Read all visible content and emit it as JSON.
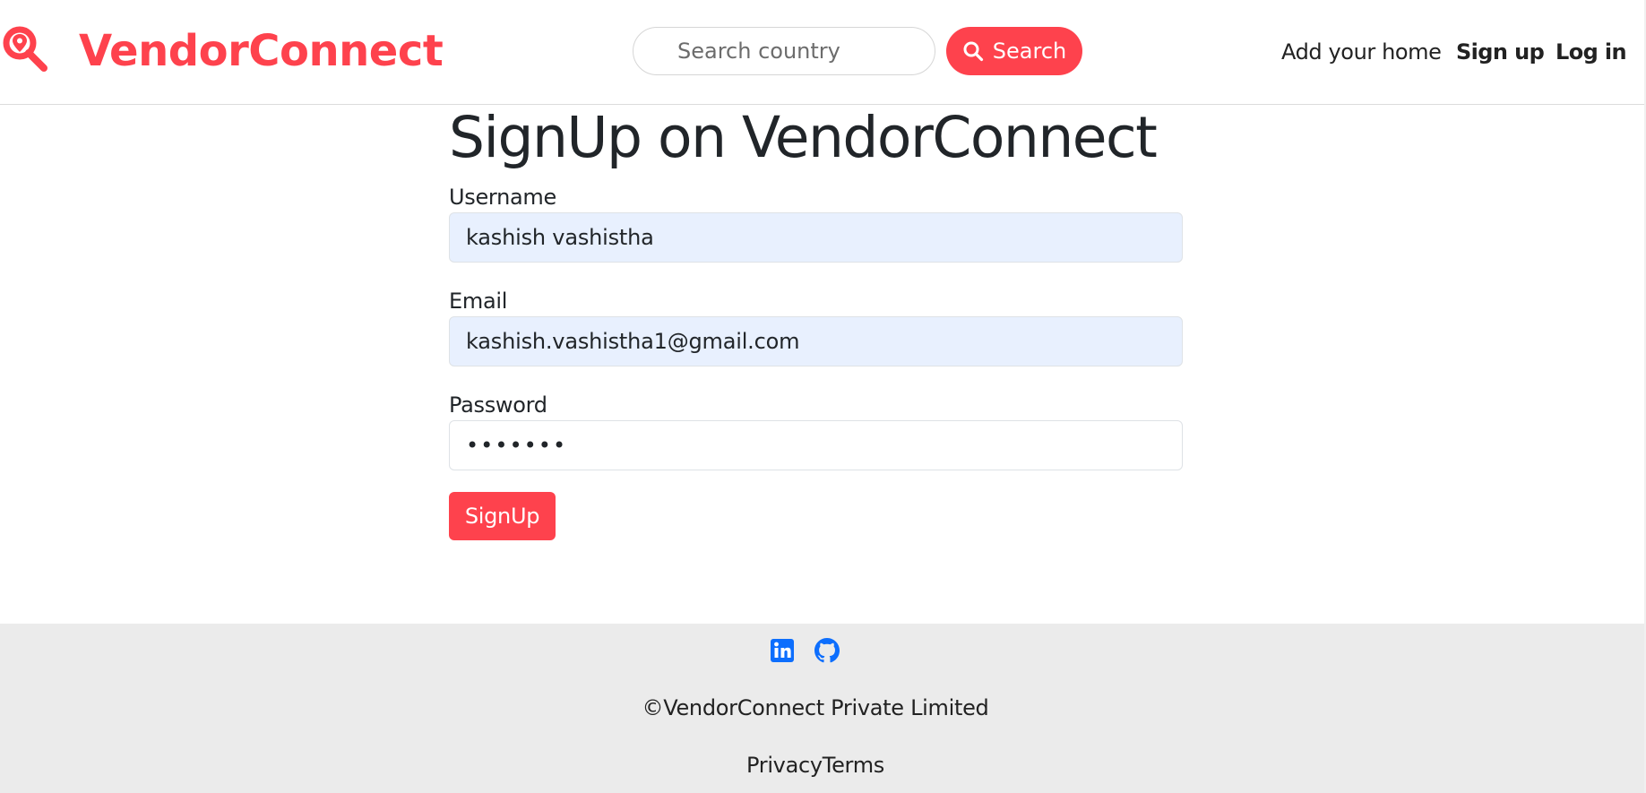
{
  "navbar": {
    "brand_name": "VendorConnect",
    "brand_icon": "map-pin-search-icon",
    "search": {
      "placeholder": "Search country",
      "value": "",
      "button_label": "Search",
      "button_icon": "search-icon"
    },
    "links": {
      "add_home": "Add your home",
      "signup": "Sign up",
      "login": "Log in"
    }
  },
  "form": {
    "title": "SignUp on VendorConnect",
    "username": {
      "label": "Username",
      "value": "kashish vashistha"
    },
    "email": {
      "label": "Email",
      "value": "kashish.vashistha1@gmail.com"
    },
    "password": {
      "label": "Password",
      "value": "•••••••"
    },
    "submit_label": "SignUp"
  },
  "footer": {
    "social_icons": [
      "linkedin-icon",
      "github-icon"
    ],
    "copyright": "©VendorConnect Private Limited",
    "privacy_label": "Privacy",
    "terms_label": "Terms"
  },
  "colors": {
    "accent": "#fe424d",
    "autofill_bg": "#e8f0fe",
    "footer_bg": "#ebebeb",
    "social_blue": "#0d6efd"
  }
}
